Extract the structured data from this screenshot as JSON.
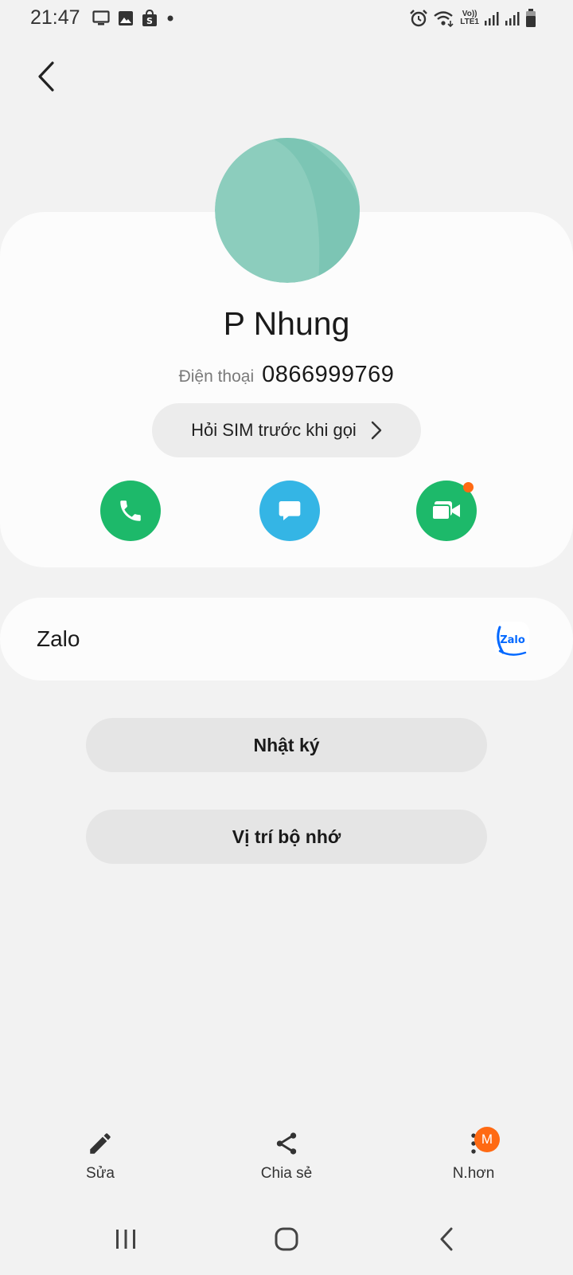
{
  "status_bar": {
    "time": "21:47",
    "left_icons": [
      "monitor-icon",
      "image-icon",
      "shopee-icon",
      "dot-icon"
    ],
    "right_icons": [
      "alarm-icon",
      "wifi-icon",
      "volte-icon",
      "signal-icon",
      "signal-icon",
      "battery-icon"
    ],
    "volte_text_top": "Vo))",
    "volte_text_bottom": "LTE1"
  },
  "contact": {
    "name": "P Nhung",
    "phone_type": "Điện thoại",
    "phone_number": "0866999769",
    "sim_prompt": "Hỏi SIM trước khi gọi",
    "avatar_color": "#8ccdbd",
    "actions": [
      {
        "name": "call",
        "icon": "phone-icon",
        "color": "#1db96a"
      },
      {
        "name": "message",
        "icon": "message-icon",
        "color": "#34b5e5"
      },
      {
        "name": "video-call",
        "icon": "video-icon",
        "color": "#1db96a",
        "notification_dot": "#ff6a13"
      }
    ]
  },
  "linked_apps": {
    "zalo_label": "Zalo",
    "zalo_logo_text": "Zalo"
  },
  "buttons": {
    "log": "Nhật ký",
    "storage_location": "Vị trí bộ nhớ"
  },
  "bottom_bar": {
    "edit": "Sửa",
    "share": "Chia sẻ",
    "more": "N.hơn",
    "more_badge": "M"
  },
  "nav_bar": [
    "recents-icon",
    "home-icon",
    "back-icon"
  ]
}
